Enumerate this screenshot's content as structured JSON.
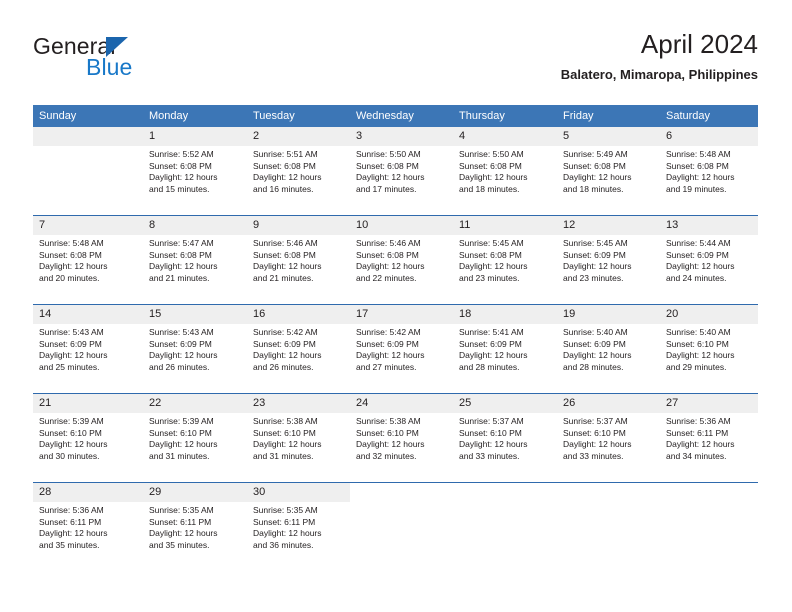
{
  "brand": {
    "name_part1": "General",
    "name_part2": "Blue",
    "logo_icon": "triangle-icon"
  },
  "header": {
    "title": "April 2024",
    "subtitle": "Balatero, Mimaropa, Philippines"
  },
  "calendar": {
    "weekday_headers": [
      "Sunday",
      "Monday",
      "Tuesday",
      "Wednesday",
      "Thursday",
      "Friday",
      "Saturday"
    ],
    "accent_color": "#3c76b6",
    "daynum_band_color": "#efefef",
    "weeks": [
      [
        {
          "day": "",
          "sunrise": "",
          "sunset": "",
          "daylight_line1": "",
          "daylight_line2": ""
        },
        {
          "day": "1",
          "sunrise": "Sunrise: 5:52 AM",
          "sunset": "Sunset: 6:08 PM",
          "daylight_line1": "Daylight: 12 hours",
          "daylight_line2": "and 15 minutes."
        },
        {
          "day": "2",
          "sunrise": "Sunrise: 5:51 AM",
          "sunset": "Sunset: 6:08 PM",
          "daylight_line1": "Daylight: 12 hours",
          "daylight_line2": "and 16 minutes."
        },
        {
          "day": "3",
          "sunrise": "Sunrise: 5:50 AM",
          "sunset": "Sunset: 6:08 PM",
          "daylight_line1": "Daylight: 12 hours",
          "daylight_line2": "and 17 minutes."
        },
        {
          "day": "4",
          "sunrise": "Sunrise: 5:50 AM",
          "sunset": "Sunset: 6:08 PM",
          "daylight_line1": "Daylight: 12 hours",
          "daylight_line2": "and 18 minutes."
        },
        {
          "day": "5",
          "sunrise": "Sunrise: 5:49 AM",
          "sunset": "Sunset: 6:08 PM",
          "daylight_line1": "Daylight: 12 hours",
          "daylight_line2": "and 18 minutes."
        },
        {
          "day": "6",
          "sunrise": "Sunrise: 5:48 AM",
          "sunset": "Sunset: 6:08 PM",
          "daylight_line1": "Daylight: 12 hours",
          "daylight_line2": "and 19 minutes."
        }
      ],
      [
        {
          "day": "7",
          "sunrise": "Sunrise: 5:48 AM",
          "sunset": "Sunset: 6:08 PM",
          "daylight_line1": "Daylight: 12 hours",
          "daylight_line2": "and 20 minutes."
        },
        {
          "day": "8",
          "sunrise": "Sunrise: 5:47 AM",
          "sunset": "Sunset: 6:08 PM",
          "daylight_line1": "Daylight: 12 hours",
          "daylight_line2": "and 21 minutes."
        },
        {
          "day": "9",
          "sunrise": "Sunrise: 5:46 AM",
          "sunset": "Sunset: 6:08 PM",
          "daylight_line1": "Daylight: 12 hours",
          "daylight_line2": "and 21 minutes."
        },
        {
          "day": "10",
          "sunrise": "Sunrise: 5:46 AM",
          "sunset": "Sunset: 6:08 PM",
          "daylight_line1": "Daylight: 12 hours",
          "daylight_line2": "and 22 minutes."
        },
        {
          "day": "11",
          "sunrise": "Sunrise: 5:45 AM",
          "sunset": "Sunset: 6:08 PM",
          "daylight_line1": "Daylight: 12 hours",
          "daylight_line2": "and 23 minutes."
        },
        {
          "day": "12",
          "sunrise": "Sunrise: 5:45 AM",
          "sunset": "Sunset: 6:09 PM",
          "daylight_line1": "Daylight: 12 hours",
          "daylight_line2": "and 23 minutes."
        },
        {
          "day": "13",
          "sunrise": "Sunrise: 5:44 AM",
          "sunset": "Sunset: 6:09 PM",
          "daylight_line1": "Daylight: 12 hours",
          "daylight_line2": "and 24 minutes."
        }
      ],
      [
        {
          "day": "14",
          "sunrise": "Sunrise: 5:43 AM",
          "sunset": "Sunset: 6:09 PM",
          "daylight_line1": "Daylight: 12 hours",
          "daylight_line2": "and 25 minutes."
        },
        {
          "day": "15",
          "sunrise": "Sunrise: 5:43 AM",
          "sunset": "Sunset: 6:09 PM",
          "daylight_line1": "Daylight: 12 hours",
          "daylight_line2": "and 26 minutes."
        },
        {
          "day": "16",
          "sunrise": "Sunrise: 5:42 AM",
          "sunset": "Sunset: 6:09 PM",
          "daylight_line1": "Daylight: 12 hours",
          "daylight_line2": "and 26 minutes."
        },
        {
          "day": "17",
          "sunrise": "Sunrise: 5:42 AM",
          "sunset": "Sunset: 6:09 PM",
          "daylight_line1": "Daylight: 12 hours",
          "daylight_line2": "and 27 minutes."
        },
        {
          "day": "18",
          "sunrise": "Sunrise: 5:41 AM",
          "sunset": "Sunset: 6:09 PM",
          "daylight_line1": "Daylight: 12 hours",
          "daylight_line2": "and 28 minutes."
        },
        {
          "day": "19",
          "sunrise": "Sunrise: 5:40 AM",
          "sunset": "Sunset: 6:09 PM",
          "daylight_line1": "Daylight: 12 hours",
          "daylight_line2": "and 28 minutes."
        },
        {
          "day": "20",
          "sunrise": "Sunrise: 5:40 AM",
          "sunset": "Sunset: 6:10 PM",
          "daylight_line1": "Daylight: 12 hours",
          "daylight_line2": "and 29 minutes."
        }
      ],
      [
        {
          "day": "21",
          "sunrise": "Sunrise: 5:39 AM",
          "sunset": "Sunset: 6:10 PM",
          "daylight_line1": "Daylight: 12 hours",
          "daylight_line2": "and 30 minutes."
        },
        {
          "day": "22",
          "sunrise": "Sunrise: 5:39 AM",
          "sunset": "Sunset: 6:10 PM",
          "daylight_line1": "Daylight: 12 hours",
          "daylight_line2": "and 31 minutes."
        },
        {
          "day": "23",
          "sunrise": "Sunrise: 5:38 AM",
          "sunset": "Sunset: 6:10 PM",
          "daylight_line1": "Daylight: 12 hours",
          "daylight_line2": "and 31 minutes."
        },
        {
          "day": "24",
          "sunrise": "Sunrise: 5:38 AM",
          "sunset": "Sunset: 6:10 PM",
          "daylight_line1": "Daylight: 12 hours",
          "daylight_line2": "and 32 minutes."
        },
        {
          "day": "25",
          "sunrise": "Sunrise: 5:37 AM",
          "sunset": "Sunset: 6:10 PM",
          "daylight_line1": "Daylight: 12 hours",
          "daylight_line2": "and 33 minutes."
        },
        {
          "day": "26",
          "sunrise": "Sunrise: 5:37 AM",
          "sunset": "Sunset: 6:10 PM",
          "daylight_line1": "Daylight: 12 hours",
          "daylight_line2": "and 33 minutes."
        },
        {
          "day": "27",
          "sunrise": "Sunrise: 5:36 AM",
          "sunset": "Sunset: 6:11 PM",
          "daylight_line1": "Daylight: 12 hours",
          "daylight_line2": "and 34 minutes."
        }
      ],
      [
        {
          "day": "28",
          "sunrise": "Sunrise: 5:36 AM",
          "sunset": "Sunset: 6:11 PM",
          "daylight_line1": "Daylight: 12 hours",
          "daylight_line2": "and 35 minutes."
        },
        {
          "day": "29",
          "sunrise": "Sunrise: 5:35 AM",
          "sunset": "Sunset: 6:11 PM",
          "daylight_line1": "Daylight: 12 hours",
          "daylight_line2": "and 35 minutes."
        },
        {
          "day": "30",
          "sunrise": "Sunrise: 5:35 AM",
          "sunset": "Sunset: 6:11 PM",
          "daylight_line1": "Daylight: 12 hours",
          "daylight_line2": "and 36 minutes."
        },
        {
          "day": "",
          "sunrise": "",
          "sunset": "",
          "daylight_line1": "",
          "daylight_line2": ""
        },
        {
          "day": "",
          "sunrise": "",
          "sunset": "",
          "daylight_line1": "",
          "daylight_line2": ""
        },
        {
          "day": "",
          "sunrise": "",
          "sunset": "",
          "daylight_line1": "",
          "daylight_line2": ""
        },
        {
          "day": "",
          "sunrise": "",
          "sunset": "",
          "daylight_line1": "",
          "daylight_line2": ""
        }
      ]
    ]
  }
}
